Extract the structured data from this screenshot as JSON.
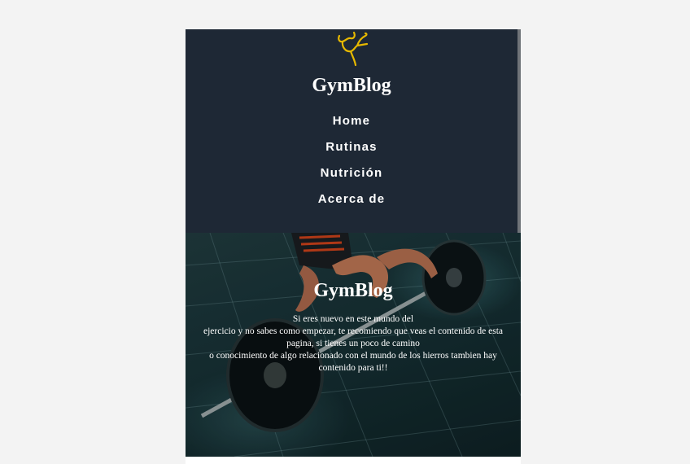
{
  "header": {
    "logo_icon": "flexing-arm-icon",
    "site_title": "GymBlog",
    "background_color": "#1e2835",
    "logo_color": "#e6b800"
  },
  "nav": {
    "items": [
      {
        "label": "Home"
      },
      {
        "label": "Rutinas"
      },
      {
        "label": "Nutrición"
      },
      {
        "label": "Acerca de"
      }
    ]
  },
  "hero": {
    "image": "weightlifter-barbell-photo",
    "title": "GymBlog",
    "text_lines": [
      "Si eres nuevo en este mundo del",
      "ejercicio y no sabes como empezar, te recomiendo que veas el contenido de esta",
      "pagina, si tienes un poco de camino",
      "o conocimiento de algo relacionado con el mundo de los hierros tambien hay",
      "contenido para ti!!"
    ]
  }
}
